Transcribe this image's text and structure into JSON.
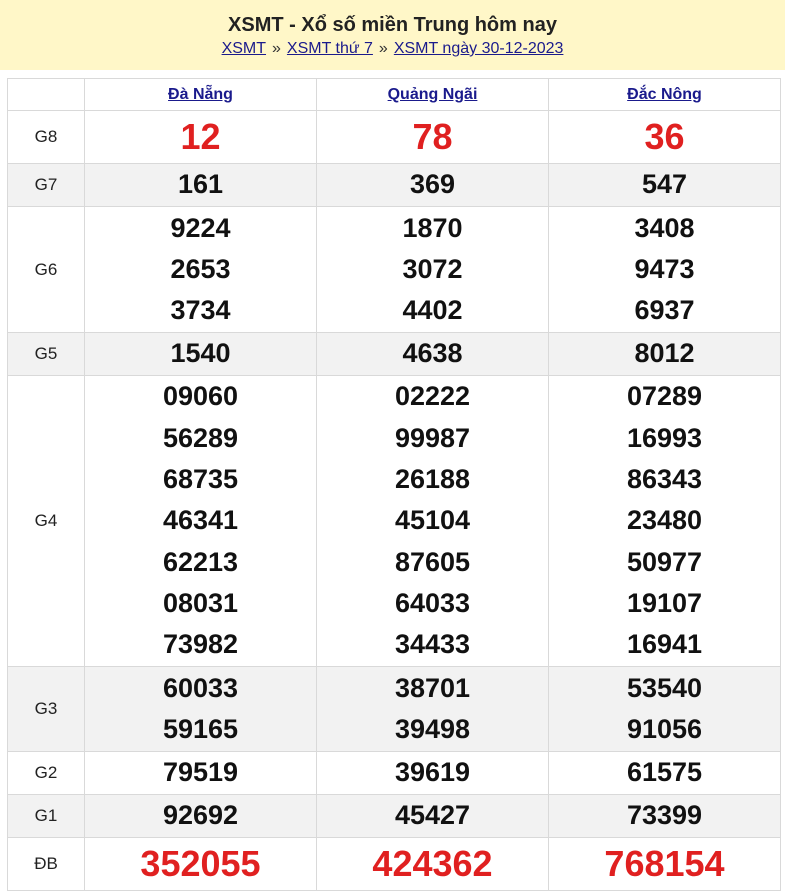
{
  "header": {
    "title": "XSMT - Xổ số miền Trung hôm nay",
    "crumbs": [
      "XSMT",
      "XSMT thứ 7",
      "XSMT ngày 30-12-2023"
    ],
    "separator": "»"
  },
  "provinces": [
    "Đà Nẵng",
    "Quảng Ngãi",
    "Đắc Nông"
  ],
  "prizes": [
    {
      "label": "G8",
      "values": [
        [
          "12"
        ],
        [
          "78"
        ],
        [
          "36"
        ]
      ]
    },
    {
      "label": "G7",
      "values": [
        [
          "161"
        ],
        [
          "369"
        ],
        [
          "547"
        ]
      ]
    },
    {
      "label": "G6",
      "values": [
        [
          "9224",
          "2653",
          "3734"
        ],
        [
          "1870",
          "3072",
          "4402"
        ],
        [
          "3408",
          "9473",
          "6937"
        ]
      ]
    },
    {
      "label": "G5",
      "values": [
        [
          "1540"
        ],
        [
          "4638"
        ],
        [
          "8012"
        ]
      ]
    },
    {
      "label": "G4",
      "values": [
        [
          "09060",
          "56289",
          "68735",
          "46341",
          "62213",
          "08031",
          "73982"
        ],
        [
          "02222",
          "99987",
          "26188",
          "45104",
          "87605",
          "64033",
          "34433"
        ],
        [
          "07289",
          "16993",
          "86343",
          "23480",
          "50977",
          "19107",
          "16941"
        ]
      ]
    },
    {
      "label": "G3",
      "values": [
        [
          "60033",
          "59165"
        ],
        [
          "38701",
          "39498"
        ],
        [
          "53540",
          "91056"
        ]
      ]
    },
    {
      "label": "G2",
      "values": [
        [
          "79519"
        ],
        [
          "39619"
        ],
        [
          "61575"
        ]
      ]
    },
    {
      "label": "G1",
      "values": [
        [
          "92692"
        ],
        [
          "45427"
        ],
        [
          "73399"
        ]
      ]
    },
    {
      "label": "ĐB",
      "values": [
        [
          "352055"
        ],
        [
          "424362"
        ],
        [
          "768154"
        ]
      ]
    }
  ],
  "colors": {
    "accent_red": "#e02020",
    "header_bg": "#fff7c8",
    "link": "#1a1a8c"
  }
}
